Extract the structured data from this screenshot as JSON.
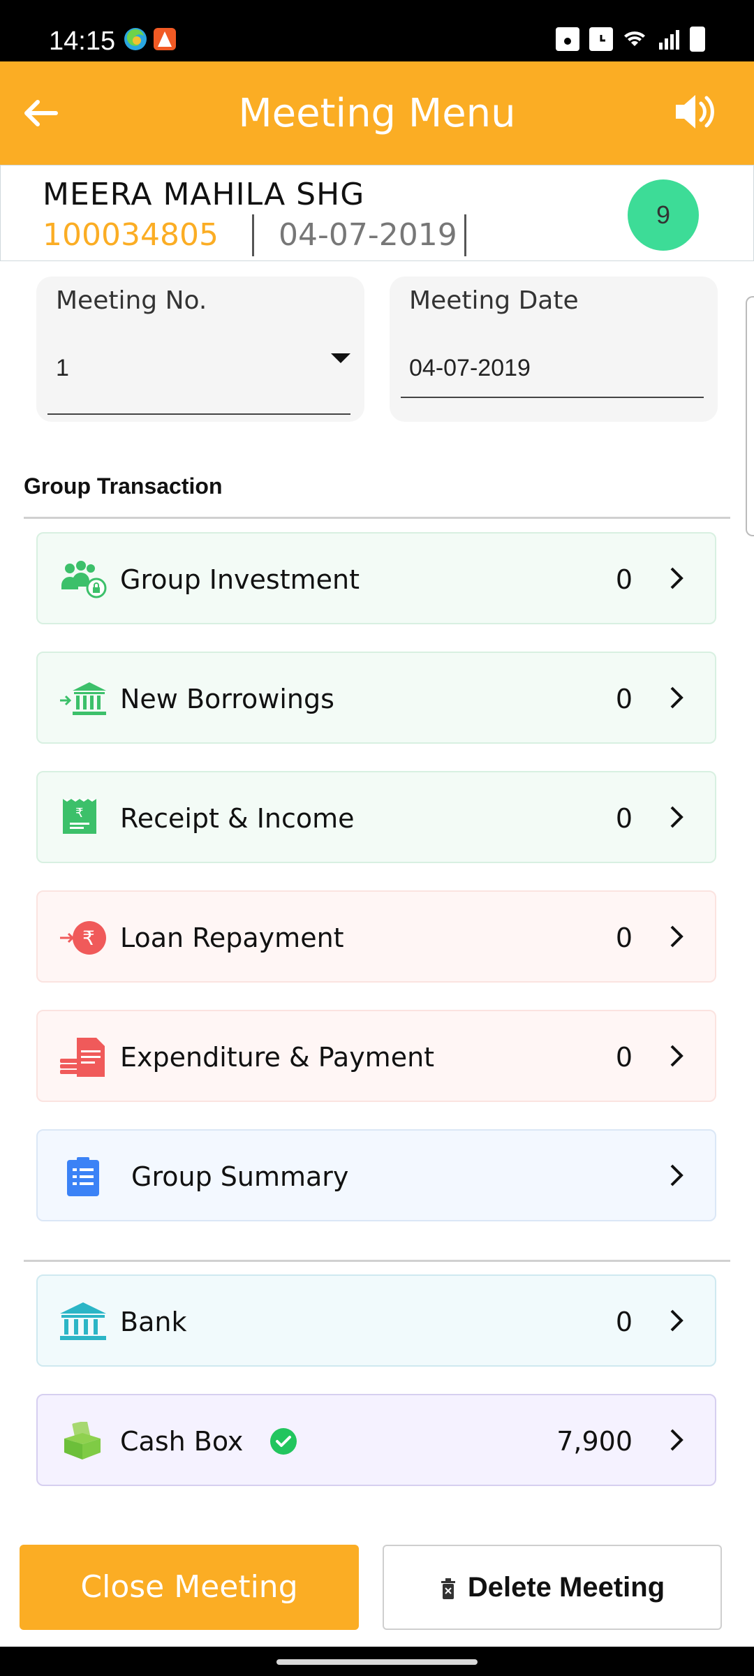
{
  "status_bar": {
    "time": "14:15",
    "icons": [
      "edge-browser-icon",
      "orange-app-icon",
      "battery-saver-icon",
      "alarm-icon",
      "wifi-icon",
      "signal-icon",
      "battery-icon"
    ]
  },
  "app_bar": {
    "title": "Meeting Menu",
    "back_icon": "arrow-left-icon",
    "speaker_icon": "volume-icon"
  },
  "group": {
    "name": "MEERA MAHILA SHG",
    "code": "100034805",
    "date": "04-07-2019",
    "badge": "9"
  },
  "meeting_fields": {
    "meeting_no_label": "Meeting No.",
    "meeting_no_value": "1",
    "meeting_date_label": "Meeting Date",
    "meeting_date_value": "04-07-2019"
  },
  "section_title": "Group Transaction",
  "menu": [
    {
      "label": "Group Investment",
      "value": "0"
    },
    {
      "label": "New Borrowings",
      "value": "0"
    },
    {
      "label": "Receipt & Income",
      "value": "0"
    },
    {
      "label": "Loan Repayment",
      "value": "0"
    },
    {
      "label": "Expenditure & Payment",
      "value": "0"
    },
    {
      "label": "Group Summary",
      "value": ""
    }
  ],
  "accounts": [
    {
      "label": "Bank",
      "value": "0"
    },
    {
      "label": "Cash Box",
      "value": "7,900"
    }
  ],
  "buttons": {
    "close_meeting": "Close Meeting",
    "delete_meeting": "Delete Meeting"
  },
  "colors": {
    "accent": "#fbad24",
    "badge": "#3ddc97",
    "check": "#22c55e"
  }
}
